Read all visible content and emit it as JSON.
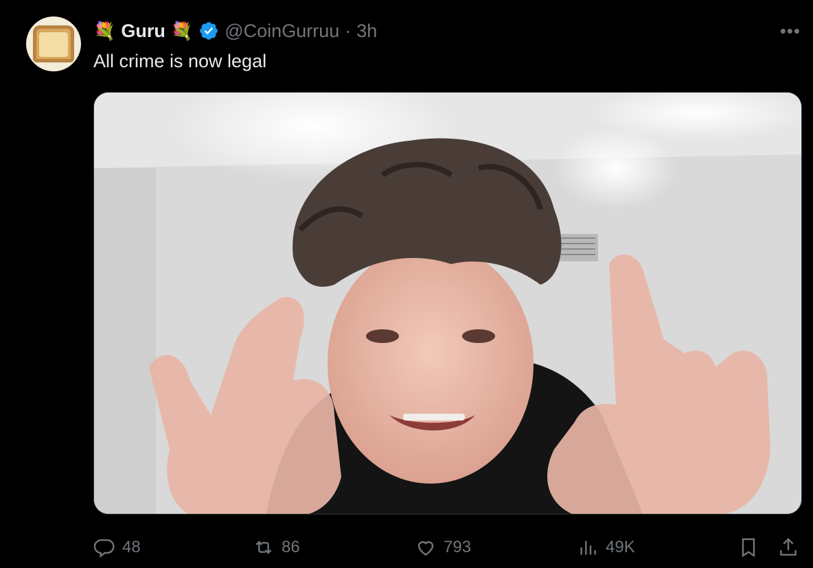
{
  "tweet": {
    "display_name": "Guru",
    "name_emoji": "💐",
    "handle": "@CoinGurruu",
    "separator": "·",
    "time": "3h",
    "more_label": "•••",
    "text": "All crime is now legal"
  },
  "actions": {
    "replies": "48",
    "retweets": "86",
    "likes": "793",
    "views": "49K"
  },
  "icons": {
    "avatar": "toast-avatar",
    "verified": "verified-badge-icon",
    "reply": "reply-icon",
    "retweet": "retweet-icon",
    "like": "heart-icon",
    "views": "views-chart-icon",
    "bookmark": "bookmark-icon",
    "share": "share-icon"
  },
  "colors": {
    "background": "#000000",
    "text": "#e7e9ea",
    "secondary": "#71767b",
    "verified": "#1d9bf0"
  }
}
